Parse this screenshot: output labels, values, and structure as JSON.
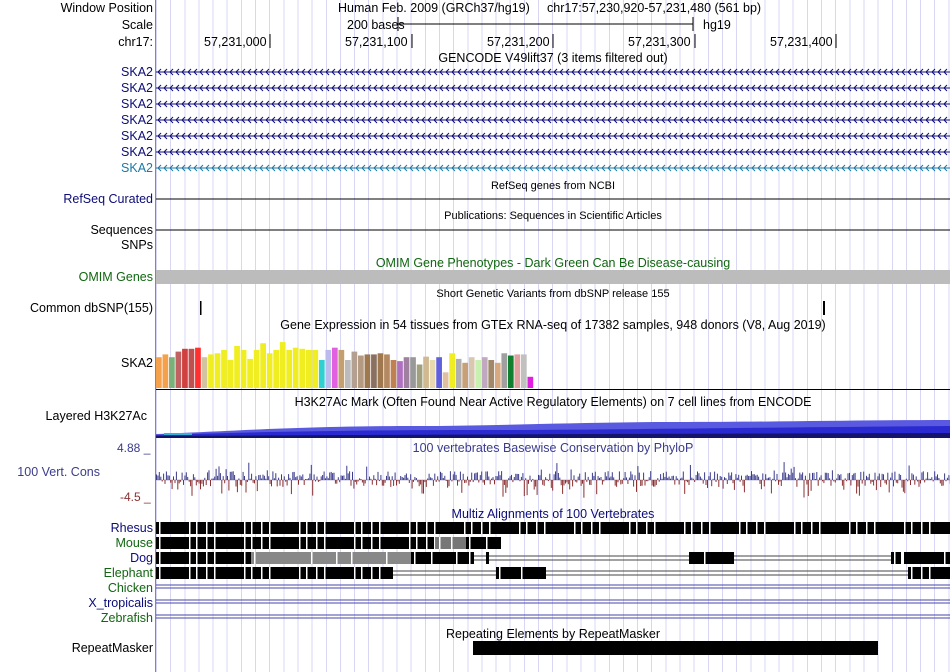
{
  "header": {
    "window_position_label": "Window Position",
    "assembly": "Human Feb. 2009 (GRCh37/hg19)",
    "position": "chr17:57,230,920-57,231,480 (561 bp)",
    "scale_label": "Scale",
    "scale_text": "200 bases",
    "scale_db": "hg19",
    "chrom_label": "chr17:",
    "ticks": [
      "57,231,000",
      "57,231,100",
      "57,231,200",
      "57,231,300",
      "57,231,400"
    ]
  },
  "gencode": {
    "title": "GENCODE V49lift37 (3 items filtered out)",
    "genes": [
      "SKA2",
      "SKA2",
      "SKA2",
      "SKA2",
      "SKA2",
      "SKA2",
      "SKA2"
    ],
    "colors": [
      "#0c0c78",
      "#0c0c78",
      "#0c0c78",
      "#0c0c78",
      "#0c0c78",
      "#0c0c78",
      "#1a7aa6"
    ]
  },
  "refseq": {
    "title": "RefSeq genes from NCBI",
    "label": "RefSeq Curated"
  },
  "publications": {
    "title": "Publications: Sequences in Scientific Articles",
    "label": "Sequences"
  },
  "snps_label": "SNPs",
  "omim": {
    "title": "OMIM Gene Phenotypes - Dark Green Can Be Disease-causing",
    "label": "OMIM Genes",
    "color": "#116611"
  },
  "dbsnp": {
    "title": "Short Genetic Variants from dbSNP release 155",
    "label": "Common dbSNP(155)"
  },
  "gtex": {
    "title": "Gene Expression in 54 tissues from GTEx RNA-seq of 17382 samples, 948 donors (V8, Aug 2019)",
    "label": "SKA2",
    "values": [
      0.55,
      0.6,
      0.55,
      0.65,
      0.7,
      0.7,
      0.72,
      0.55,
      0.6,
      0.62,
      0.68,
      0.5,
      0.75,
      0.68,
      0.52,
      0.68,
      0.8,
      0.62,
      0.68,
      0.82,
      0.68,
      0.72,
      0.7,
      0.68,
      0.68,
      0.5,
      0.68,
      0.72,
      0.68,
      0.5,
      0.65,
      0.58,
      0.6,
      0.6,
      0.62,
      0.6,
      0.5,
      0.48,
      0.55,
      0.55,
      0.42,
      0.56,
      0.5,
      0.55,
      0.28,
      0.62,
      0.52,
      0.45,
      0.55,
      0.5,
      0.55,
      0.5,
      0.45,
      0.62,
      0.58,
      0.6,
      0.6,
      0.2
    ],
    "colors": [
      "#f5a04a",
      "#f5a04a",
      "#7ab07a",
      "#c06060",
      "#d04040",
      "#c05050",
      "#ff3030",
      "#d2c4a0",
      "#f0ee20",
      "#f0ee20",
      "#f0ee20",
      "#f0ee20",
      "#f0ee20",
      "#f0ee20",
      "#f0ee20",
      "#f0ee20",
      "#f0ee20",
      "#f0ee20",
      "#f0ee20",
      "#f0ee20",
      "#f0ee20",
      "#f0ee20",
      "#f0ee20",
      "#f0ee20",
      "#f0ee20",
      "#30d0d0",
      "#bbbbee",
      "#e060e0",
      "#c4a070",
      "#bbbbbb",
      "#b4a090",
      "#b49a80",
      "#a07850",
      "#8a7060",
      "#a07850",
      "#b48860",
      "#c08050",
      "#b070c0",
      "#a080a0",
      "#999999",
      "#a0a080",
      "#d0b890",
      "#e8d8b0",
      "#6060dd",
      "#e0c0a0",
      "#f0ee20",
      "#b0b0b0",
      "#c8a078",
      "#d8c8b0",
      "#c8f0b0",
      "#c0a8c0",
      "#a08868",
      "#d8a880",
      "#a0a0a0",
      "#108030",
      "#e0a0a0",
      "#c0c0c0",
      "#e020e0"
    ]
  },
  "h3k27ac": {
    "title": "H3K27Ac Mark (Often Found Near Active Regulatory Elements) on 7 cell lines from ENCODE",
    "label": "Layered H3K27Ac"
  },
  "phylop": {
    "title": "100 vertebrates Basewise Conservation by PhyloP",
    "label": "100 Vert. Cons",
    "max": "4.88 _",
    "min": "-4.5 _",
    "colors": [
      "#3b3b8c",
      "#8a3030"
    ]
  },
  "multiz": {
    "title": "Multiz Alignments of 100 Vertebrates",
    "species": [
      "Rhesus",
      "Mouse",
      "Dog",
      "Elephant",
      "Chicken",
      "X_tropicalis",
      "Zebrafish"
    ],
    "colors": [
      "#0c0c78",
      "#116611",
      "#0c0c78",
      "#116611",
      "#116611",
      "#0c0c78",
      "#116611"
    ]
  },
  "repeatmasker": {
    "title": "Repeating Elements by RepeatMasker",
    "label": "RepeatMasker"
  }
}
